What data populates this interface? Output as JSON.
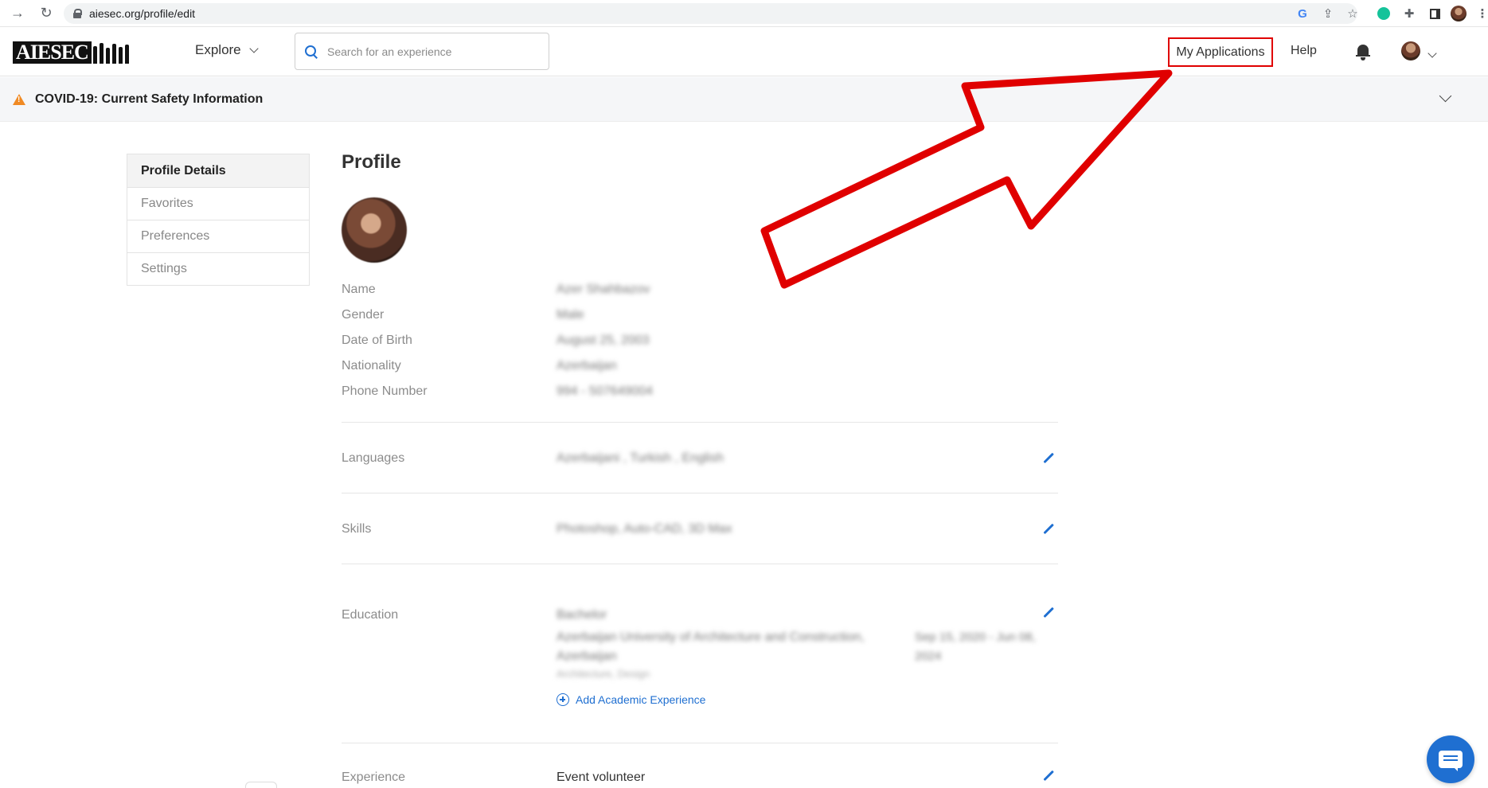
{
  "browser": {
    "url": "aiesec.org/profile/edit"
  },
  "header": {
    "logo_text": "AIESEC",
    "explore_label": "Explore",
    "search_placeholder": "Search for an experience",
    "my_applications_label": "My Applications",
    "help_label": "Help"
  },
  "banner": {
    "text": "COVID-19: Current Safety Information"
  },
  "sidebar": {
    "items": [
      {
        "label": "Profile Details"
      },
      {
        "label": "Favorites"
      },
      {
        "label": "Preferences"
      },
      {
        "label": "Settings"
      }
    ]
  },
  "profile": {
    "title": "Profile",
    "fields": [
      {
        "label": "Name",
        "value": "Azer Shahbazov"
      },
      {
        "label": "Gender",
        "value": "Male"
      },
      {
        "label": "Date of Birth",
        "value": "August 25, 2003"
      },
      {
        "label": "Nationality",
        "value": "Azerbaijan"
      },
      {
        "label": "Phone Number",
        "value": "994 - 507649004"
      }
    ],
    "languages": {
      "label": "Languages",
      "value": "Azerbaijani , Turkish , English"
    },
    "skills": {
      "label": "Skills",
      "value": "Photoshop, Auto-CAD, 3D Max"
    },
    "education": {
      "label": "Education",
      "degree": "Bachelor",
      "institution": "Azerbaijan University of Architecture and Construction, Azerbaijan",
      "dates": "Sep 15, 2020 - Jun 08, 2024",
      "field": "Architecture, Design",
      "add_label": "Add Academic Experience"
    },
    "experience": {
      "label": "Experience",
      "value": "Event volunteer"
    }
  },
  "colors": {
    "accent": "#1f6fd1",
    "annotation": "#e00000",
    "warning": "#f08a24"
  }
}
